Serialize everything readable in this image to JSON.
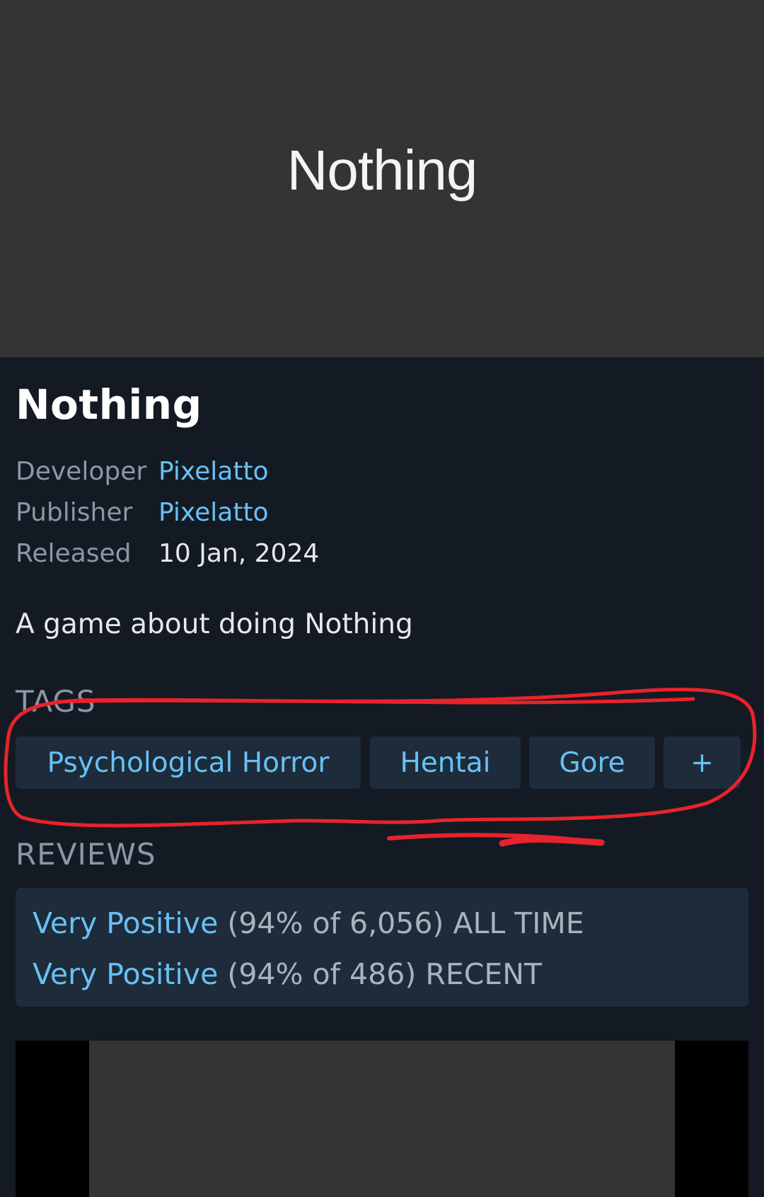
{
  "header": {
    "capsule_title": "Nothing"
  },
  "game": {
    "title": "Nothing",
    "description": "A game about doing Nothing"
  },
  "details": {
    "developer_label": "Developer",
    "developer": "Pixelatto",
    "publisher_label": "Publisher",
    "publisher": "Pixelatto",
    "released_label": "Released",
    "released": "10 Jan, 2024"
  },
  "tags": {
    "heading": "TAGS",
    "items": [
      "Psychological Horror",
      "Hentai",
      "Gore",
      "+"
    ]
  },
  "reviews": {
    "heading": "REVIEWS",
    "all_time": {
      "summary": "Very Positive",
      "detail": "(94% of 6,056)",
      "scope": "ALL TIME"
    },
    "recent": {
      "summary": "Very Positive",
      "detail": "(94% of 486)",
      "scope": "RECENT"
    }
  },
  "colors": {
    "background": "#141a23",
    "panel": "#1e2b3a",
    "link": "#67c1f5",
    "annotation": "#e8232b"
  }
}
